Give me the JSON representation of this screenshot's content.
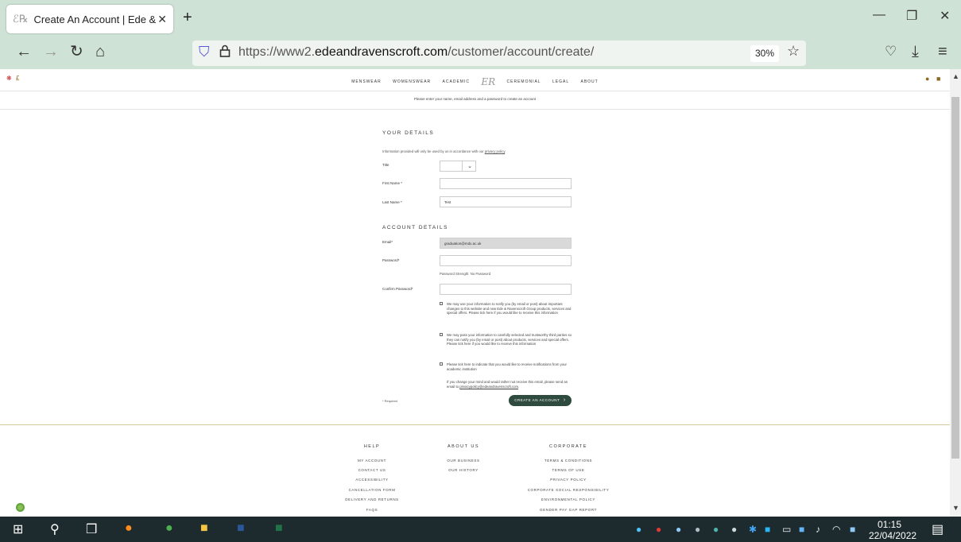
{
  "browser": {
    "tab_title": "Create An Account | Ede & Rave",
    "new_tab": "+",
    "window": {
      "minimize": "—",
      "restore": "❐",
      "close": "✕"
    },
    "url_host_prefix": "https://www2.",
    "url_host_domain": "edeandravenscroft.com",
    "url_path": "/customer/account/create/",
    "zoom": "30%"
  },
  "site": {
    "menu": [
      "MENSWEAR",
      "WOMENSWEAR",
      "ACADEMIC",
      "CEREMONIAL",
      "LEGAL",
      "ABOUT"
    ],
    "logo": "ER",
    "intro": "Please enter your name, email address and a password to create an account"
  },
  "form": {
    "your_details_title": "YOUR DETAILS",
    "info_note": "Information provided will only be used by us in accordance with our ",
    "privacy_link": "privacy policy",
    "title_label": "Title",
    "first_name_label": "First Name *",
    "first_name_value": "",
    "last_name_label": "Last Name *",
    "last_name_value": "Test",
    "account_details_title": "ACCOUNT DETAILS",
    "email_label": "Email*",
    "email_value": "graduation@mdx.ac.uk",
    "password_label": "Password*",
    "password_value": "",
    "password_strength": "Password Strength: No Password",
    "confirm_label": "Confirm Password*",
    "confirm_value": "",
    "consent1": "We may use your information to notify you (by email or post) about important changes to this website and new Ede & Ravenscroft Group products, services and special offers. Please tick here if you would like to receive this information",
    "consent2": "We may pass your information to carefully selected and trustworthy third parties so they can notify you (by email or post) about products, services and special offers. Please tick here if you would like to receive this information",
    "consent3": "Please tick here to indicate that you would like to receive notifications from your academic institution",
    "optout_text": "If you change your mind and would rather not receive this email, please send an email to ",
    "optout_email": "privacypolicy@edeandravenscroft.com",
    "required_note": "* Required",
    "create_button": "CREATE AN ACCOUNT"
  },
  "footer": {
    "help_title": "HELP",
    "help_links": [
      "MY ACCOUNT",
      "CONTACT US",
      "ACCESSIBILITY",
      "CANCELLATION FORM",
      "DELIVERY AND RETURNS",
      "FAQS"
    ],
    "about_title": "ABOUT US",
    "about_links": [
      "OUR BUSINESS",
      "OUR HISTORY"
    ],
    "corp_title": "CORPORATE",
    "corp_links": [
      "TERMS & CONDITIONS",
      "TERMS OF USE",
      "PRIVACY POLICY",
      "CORPORATE SOCIAL RESPONSIBILITY",
      "ENVIRONMENTAL POLICY",
      "GENDER PAY GAP REPORT"
    ]
  },
  "taskbar": {
    "time": "01:15",
    "date": "22/04/2022"
  },
  "colors": {
    "browser_chrome": "#cfe2d6",
    "button": "#2f4a3e",
    "taskbar": "#1e2b2e"
  }
}
